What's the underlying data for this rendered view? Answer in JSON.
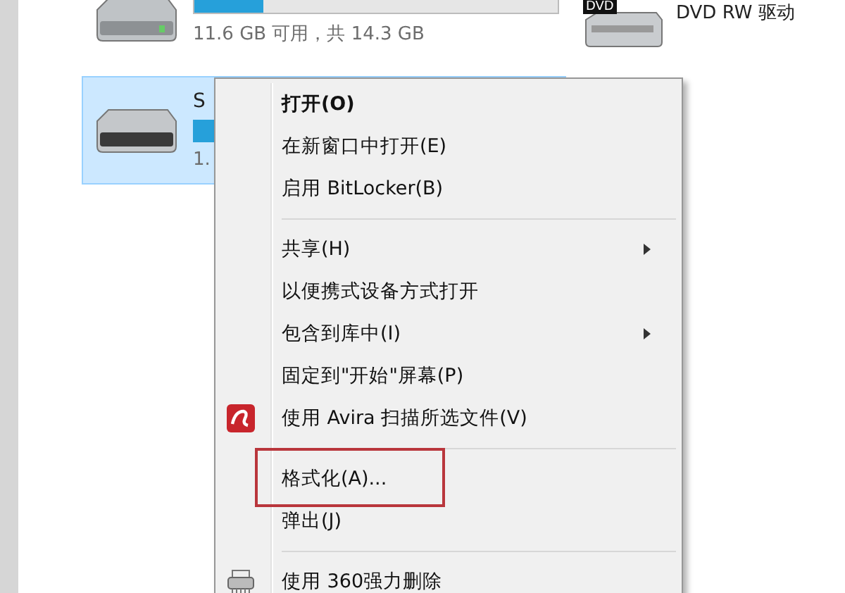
{
  "drives": [
    {
      "kind": "usb",
      "free_text": "11.6 GB 可用，共 14.3 GB",
      "level": 0.19,
      "selected": false
    },
    {
      "kind": "usb",
      "name": "S",
      "free_text": "1.",
      "selected": true
    }
  ],
  "dvd": {
    "badge": "DVD",
    "label": "DVD RW 驱动"
  },
  "context_menu": {
    "items": [
      {
        "kind": "item",
        "label": "打开(O)",
        "bold": true,
        "submenu": false,
        "highlighted": false
      },
      {
        "kind": "item",
        "label": "在新窗口中打开(E)",
        "bold": false,
        "submenu": false,
        "highlighted": false
      },
      {
        "kind": "item",
        "label": "启用 BitLocker(B)",
        "bold": false,
        "submenu": false,
        "highlighted": false
      },
      {
        "kind": "separator"
      },
      {
        "kind": "item",
        "label": "共享(H)",
        "bold": false,
        "submenu": true,
        "highlighted": false
      },
      {
        "kind": "item",
        "label": "以便携式设备方式打开",
        "bold": false,
        "submenu": false,
        "highlighted": false
      },
      {
        "kind": "item",
        "label": "包含到库中(I)",
        "bold": false,
        "submenu": true,
        "highlighted": false
      },
      {
        "kind": "item",
        "label": "固定到\"开始\"屏幕(P)",
        "bold": false,
        "submenu": false,
        "highlighted": false
      },
      {
        "kind": "item",
        "label": "使用 Avira 扫描所选文件(V)",
        "bold": false,
        "submenu": false,
        "highlighted": false
      },
      {
        "kind": "separator"
      },
      {
        "kind": "item",
        "label": "格式化(A)...",
        "bold": false,
        "submenu": false,
        "highlighted": true
      },
      {
        "kind": "item",
        "label": "弹出(J)",
        "bold": false,
        "submenu": false,
        "highlighted": false
      },
      {
        "kind": "separator"
      },
      {
        "kind": "item",
        "label": "使用 360强力删除",
        "bold": false,
        "submenu": false,
        "highlighted": false
      }
    ]
  }
}
